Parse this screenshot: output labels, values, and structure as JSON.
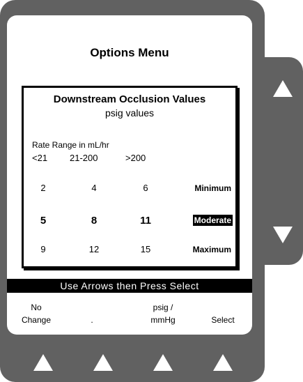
{
  "screen": {
    "title": "Options Menu"
  },
  "panel": {
    "heading": "Downstream Occlusion Values",
    "subheading": "psig values",
    "range_label": "Rate Range in mL/hr",
    "columns": [
      "<21",
      "21-200",
      ">200"
    ],
    "rows": [
      {
        "values": [
          "2",
          "4",
          "6"
        ],
        "level": "Minimum",
        "selected": false
      },
      {
        "values": [
          "5",
          "8",
          "11"
        ],
        "level": "Moderate",
        "selected": true
      },
      {
        "values": [
          "9",
          "12",
          "15"
        ],
        "level": "Maximum",
        "selected": false
      }
    ]
  },
  "status_bar": "Use Arrows then Press Select",
  "softkeys": [
    {
      "line1": "No",
      "line2": "Change"
    },
    {
      "line1": "",
      "line2": "."
    },
    {
      "line1": "psig /",
      "line2": "mmHg"
    },
    {
      "line1": "",
      "line2": "Select"
    }
  ],
  "hardware": {
    "side_arrows": [
      "up-arrow-icon",
      "down-arrow-icon"
    ],
    "bottom_arrows": [
      "up-arrow-icon",
      "up-arrow-icon",
      "up-arrow-icon",
      "up-arrow-icon"
    ],
    "housing_color": "#616161",
    "screen_color": "#ffffff",
    "highlight_color": "#000000"
  }
}
